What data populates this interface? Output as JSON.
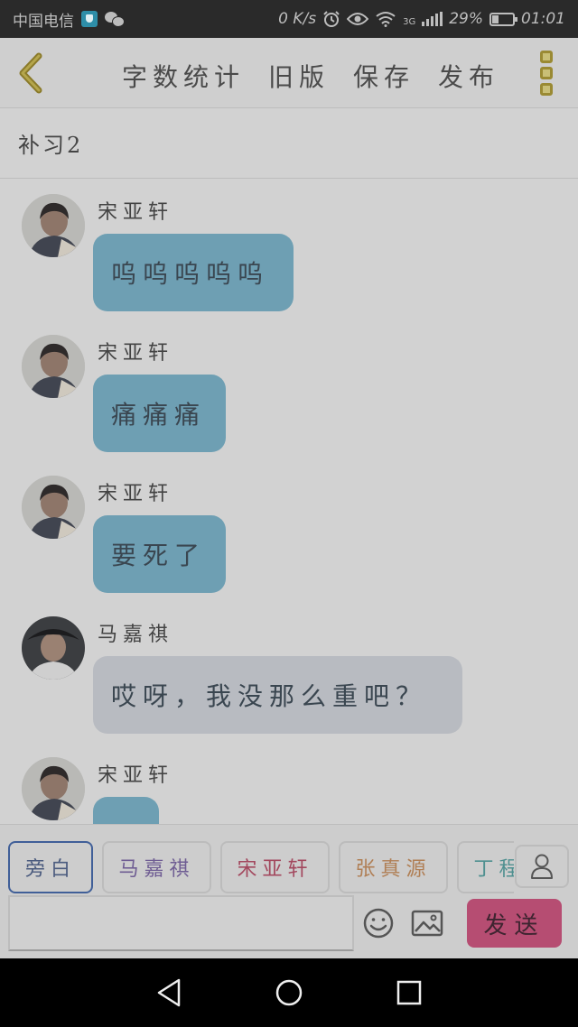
{
  "status_bar": {
    "carrier": "中国电信",
    "net_speed": "0 K/s",
    "network": "3G",
    "battery": "29%",
    "battery_level": 0.29,
    "time": "01:01",
    "icons": [
      "shield-icon",
      "wechat-icon",
      "alarm-icon",
      "eye-icon",
      "wifi-icon",
      "signal-icon",
      "battery-icon"
    ]
  },
  "toolbar": {
    "back_icon": "chevron-left-icon",
    "word_count_label": "字数统计",
    "old_version_label": "旧版",
    "save_label": "保存",
    "publish_label": "发布",
    "more_icon": "more-vertical-icon"
  },
  "title": "补习2",
  "messages": [
    {
      "sender": "宋亚轩",
      "text": "呜呜呜呜呜",
      "style": "blue"
    },
    {
      "sender": "宋亚轩",
      "text": "痛痛痛",
      "style": "blue"
    },
    {
      "sender": "宋亚轩",
      "text": "要死了",
      "style": "blue"
    },
    {
      "sender": "马嘉祺",
      "text": "哎呀，我没那么重吧？",
      "style": "grey"
    },
    {
      "sender": "宋亚轩",
      "text": "",
      "style": "blue"
    }
  ],
  "characters": [
    {
      "name": "旁白",
      "color": "#4b5b7e",
      "selected": true
    },
    {
      "name": "马嘉祺",
      "color": "#6f5d93"
    },
    {
      "name": "宋亚轩",
      "color": "#a3485e"
    },
    {
      "name": "张真源",
      "color": "#b07f55"
    },
    {
      "name": "丁程鑫",
      "color": "#4f9090"
    }
  ],
  "input": {
    "value": "",
    "placeholder": ""
  },
  "send_label": "发送",
  "colors": {
    "accent": "#b64d72",
    "back_arrow": "#9a8a33",
    "bubble_blue": "#6e9fb3",
    "bubble_grey": "#b8bbc1"
  }
}
